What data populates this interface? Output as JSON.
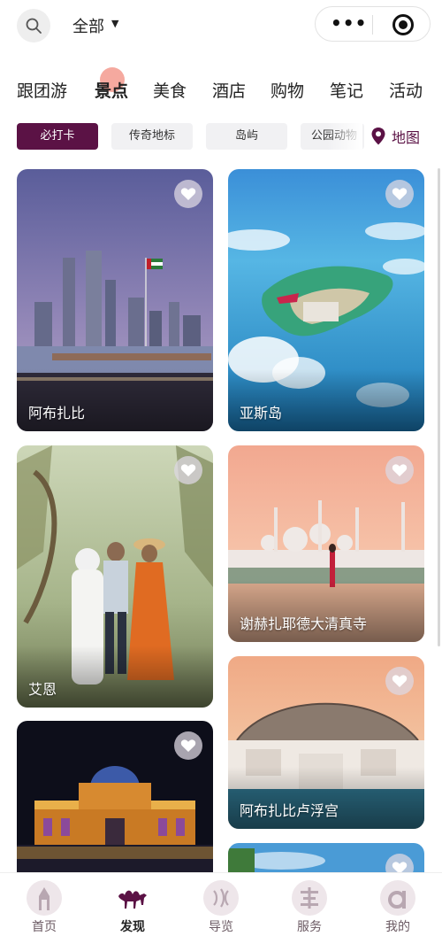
{
  "header": {
    "scope_label": "全部",
    "capsule_dots": "•••"
  },
  "category_tabs": [
    {
      "label": "跟团游",
      "active": false
    },
    {
      "label": "景点",
      "active": true
    },
    {
      "label": "美食",
      "active": false
    },
    {
      "label": "酒店",
      "active": false
    },
    {
      "label": "购物",
      "active": false
    },
    {
      "label": "笔记",
      "active": false
    },
    {
      "label": "活动",
      "active": false
    }
  ],
  "filter_chips": [
    {
      "label": "必打卡",
      "active": true
    },
    {
      "label": "传奇地标",
      "active": false
    },
    {
      "label": "岛屿",
      "active": false
    },
    {
      "label": "公园动物",
      "active": false
    }
  ],
  "map_button": {
    "label": "地图"
  },
  "cards": [
    {
      "title": "阿布扎比",
      "icon": "heart-icon"
    },
    {
      "title": "亚斯岛",
      "icon": "heart-icon"
    },
    {
      "title": "艾恩",
      "icon": "heart-icon"
    },
    {
      "title": "谢赫扎耶德大清真寺",
      "icon": "heart-icon"
    },
    {
      "title": "",
      "icon": "heart-icon"
    },
    {
      "title": "阿布扎比卢浮宫",
      "icon": "heart-icon"
    },
    {
      "title": "",
      "icon": "heart-icon"
    }
  ],
  "bottom_nav": [
    {
      "label": "首页",
      "icon": "home-icon",
      "active": false
    },
    {
      "label": "发现",
      "icon": "camel-icon",
      "active": true
    },
    {
      "label": "导览",
      "icon": "guide-icon",
      "active": false
    },
    {
      "label": "服务",
      "icon": "service-icon",
      "active": false
    },
    {
      "label": "我的",
      "icon": "profile-icon",
      "active": false
    }
  ],
  "colors": {
    "brand": "#5b1245",
    "tab_indicator": "#f39a8e",
    "chip_bg": "#f1f1f3"
  }
}
